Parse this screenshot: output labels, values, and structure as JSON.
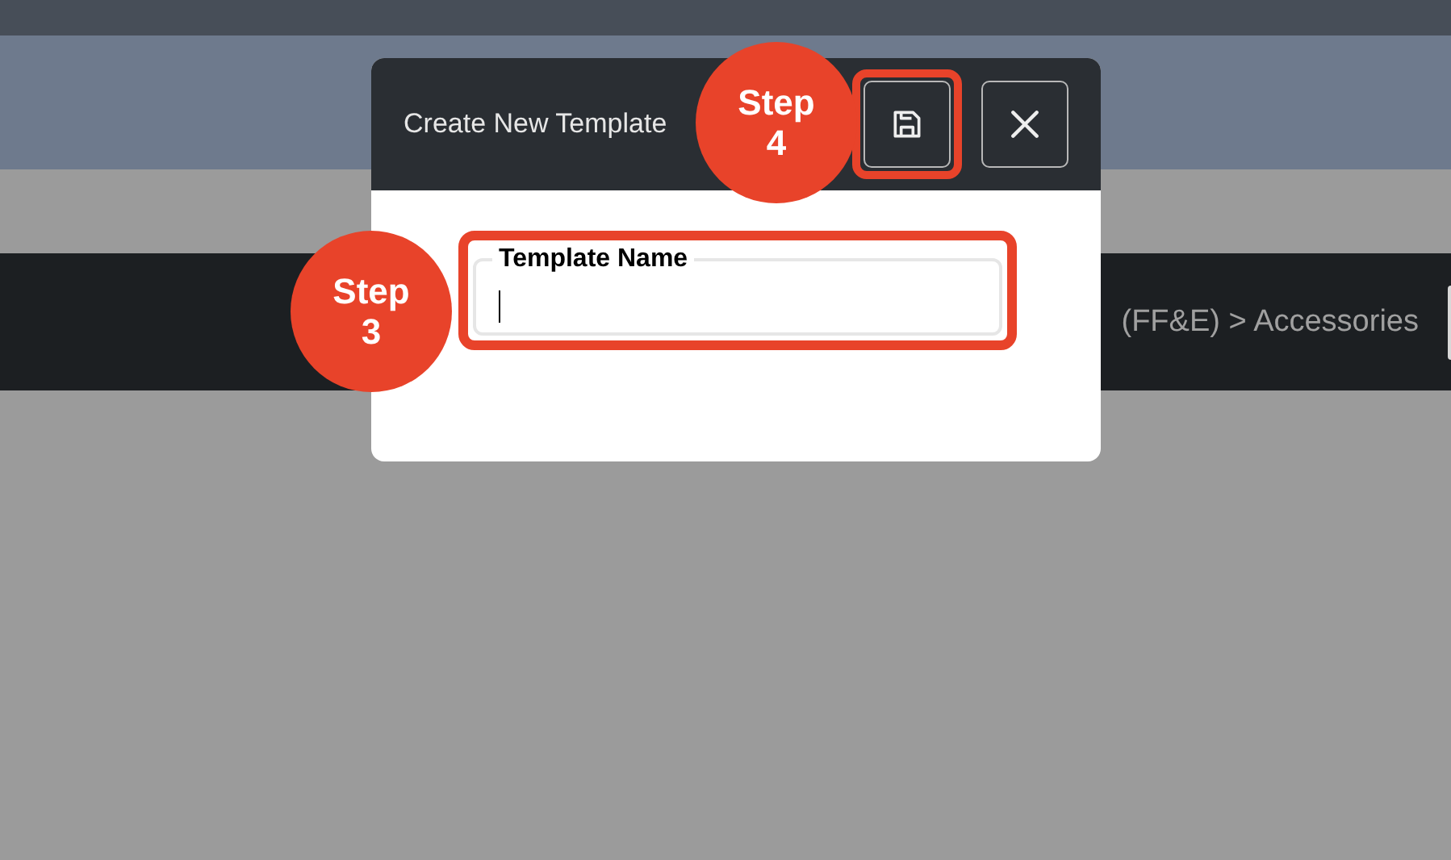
{
  "page": {
    "breadcrumb": "(FF&E) > Accessories"
  },
  "dialog": {
    "title": "Create New Template",
    "buttons": [
      {
        "kind": "save",
        "highlighted": true
      },
      {
        "kind": "close",
        "highlighted": false
      }
    ],
    "fields": [
      {
        "label": "Template Name",
        "focused": true,
        "highlighted": true
      }
    ]
  },
  "callouts": [
    {
      "text": "Step 4"
    },
    {
      "text": "Step 3"
    }
  ]
}
